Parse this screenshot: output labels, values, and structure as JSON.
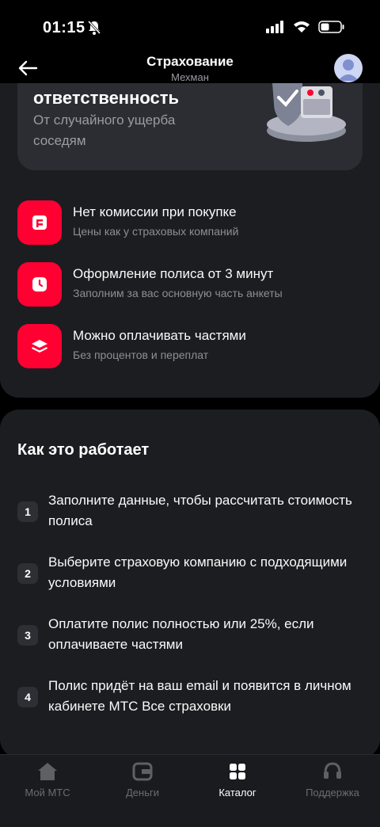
{
  "status_bar": {
    "time": "01:15"
  },
  "header": {
    "title": "Страхование",
    "subtitle": "Мехман"
  },
  "promo": {
    "title": "ответственность",
    "subtitle": "От случайного ущерба соседям"
  },
  "features": [
    {
      "icon": "wallet-icon",
      "title": "Нет комиссии при покупке",
      "subtitle": "Цены как у страховых компаний"
    },
    {
      "icon": "clock-icon",
      "title": "Оформление полиса от 3 минут",
      "subtitle": "Заполним за вас основную часть анкеты"
    },
    {
      "icon": "layers-icon",
      "title": "Можно оплачивать частями",
      "subtitle": "Без процентов и переплат"
    }
  ],
  "how_it_works": {
    "title": "Как это работает",
    "steps": [
      {
        "num": "1",
        "text": "Заполните данные, чтобы рассчитать стоимость полиса"
      },
      {
        "num": "2",
        "text": "Выберите страховую компанию с подходящими условиями"
      },
      {
        "num": "3",
        "text": "Оплатите полис полностью или 25%, если оплачиваете частями"
      },
      {
        "num": "4",
        "text": "Полис придёт на ваш email и появится в личном кабинете МТС Все страховки"
      }
    ]
  },
  "tabbar": {
    "active": "catalog",
    "tabs": [
      {
        "id": "home",
        "label": "Мой МТС",
        "icon": "home-icon"
      },
      {
        "id": "money",
        "label": "Деньги",
        "icon": "wallet-icon"
      },
      {
        "id": "catalog",
        "label": "Каталог",
        "icon": "grid-icon"
      },
      {
        "id": "support",
        "label": "Поддержка",
        "icon": "headset-icon"
      }
    ]
  },
  "colors": {
    "accent": "#ff0032",
    "panel": "#1c1d21",
    "background": "#000000"
  }
}
